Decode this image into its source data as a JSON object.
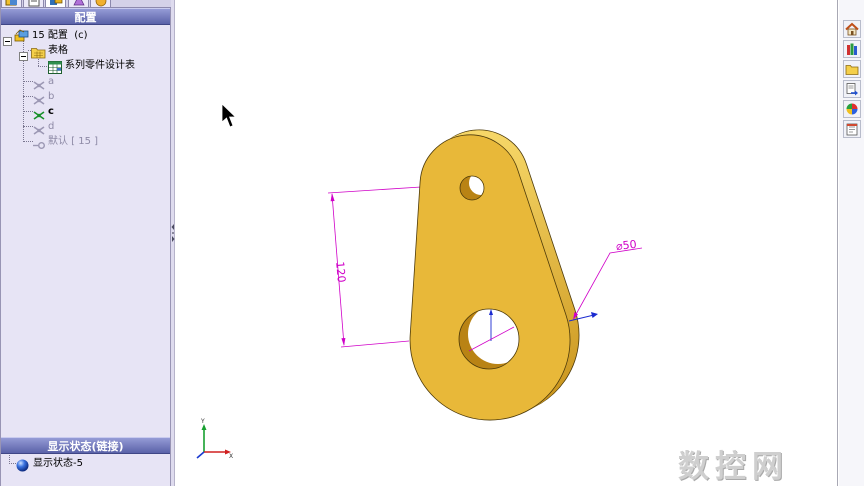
{
  "left_panel": {
    "tabs": [
      {
        "icon": "feature-manager-icon",
        "active": false
      },
      {
        "icon": "property-manager-icon",
        "active": false
      },
      {
        "icon": "configuration-manager-icon",
        "active": true
      },
      {
        "icon": "dimxpert-manager-icon",
        "active": false
      },
      {
        "icon": "display-manager-icon",
        "active": false
      }
    ],
    "header": "配置",
    "tree": {
      "root": {
        "label": "15 配置  (c)",
        "icon": "configuration-icon"
      },
      "tables": {
        "label": "表格",
        "icon": "tables-folder-icon"
      },
      "design_table": {
        "label": "系列零件设计表",
        "icon": "design-table-icon"
      },
      "configs": [
        {
          "label": "a",
          "active": false
        },
        {
          "label": "b",
          "active": false
        },
        {
          "label": "c",
          "active": true
        },
        {
          "label": "d",
          "active": false
        }
      ],
      "default_config": {
        "label": "默认 [ 15 ]",
        "icon": "default-config-icon"
      }
    },
    "display_states": {
      "header": "显示状态(链接)",
      "items": [
        {
          "label": "显示状态-5",
          "icon": "display-state-sphere-icon"
        }
      ]
    }
  },
  "viewport": {
    "part_face_color": "#e8b839",
    "dimension_color": "#d000c8",
    "dimensions": {
      "length": "120",
      "diameter": "⌀50"
    },
    "triad": {
      "x_label": "X",
      "y_label": "Y"
    }
  },
  "task_pane": {
    "icons": [
      "solidworks-resources-icon",
      "design-library-icon",
      "file-explorer-icon",
      "view-palette-icon",
      "appearances-icon",
      "custom-properties-icon"
    ]
  },
  "watermark": "数控网"
}
